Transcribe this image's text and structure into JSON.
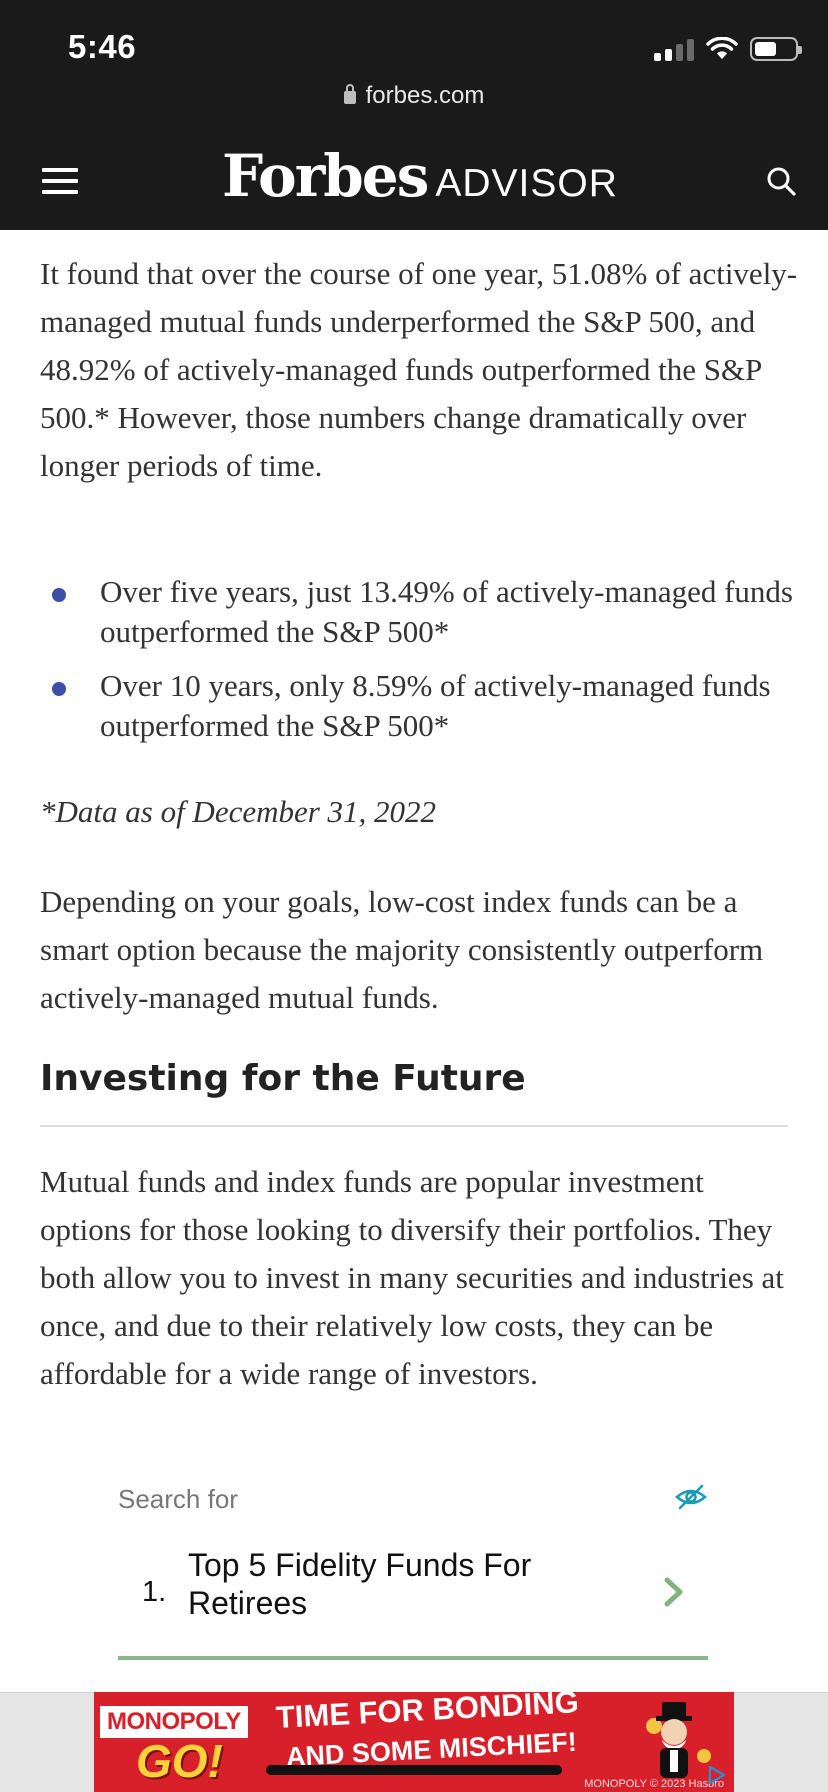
{
  "status_bar": {
    "time": "5:46",
    "signal_bars_filled": 2,
    "signal_bars_total": 4,
    "battery_level": 0.55
  },
  "browser": {
    "url": "forbes.com"
  },
  "header": {
    "logo_main": "Forbes",
    "logo_sub": "ADVISOR"
  },
  "article": {
    "paragraph_1": "It found that over the course of one year, 51.08% of actively-managed mutual funds underperformed the S&P 500, and 48.92% of actively-managed funds outperformed the S&P 500.* However, those numbers change dramatically over longer periods of time.",
    "bullets": [
      "Over five years, just 13.49% of actively-managed funds outperformed the S&P 500*",
      "Over 10 years, only 8.59% of actively-managed funds outperformed the S&P 500*"
    ],
    "note": "*Data as of December 31, 2022",
    "paragraph_2": "Depending on your goals, low-cost index funds can be a smart option because the majority consistently outperform actively-managed mutual funds.",
    "heading": "Investing for the Future",
    "paragraph_3": "Mutual funds and index funds are popular investment options for those looking to diversify their portfolios. They both allow you to invest in many securities and industries at once, and due to their relatively low costs, they can be affordable for a wide range of investors."
  },
  "search_ad": {
    "label": "Search for",
    "items": [
      {
        "number": "1.",
        "text": "Top 5 Fidelity Funds For Retirees"
      }
    ]
  },
  "banner_ad": {
    "brand_top": "MONOPOLY",
    "brand_go": "GO!",
    "line1": "TIME FOR BONDING",
    "line2": "AND SOME MISCHIEF!",
    "fine_print": "MONOPOLY © 2023 Hasbro"
  },
  "colors": {
    "header_bg": "#1a1a1a",
    "bullet": "#3b4fa8",
    "ad_accent": "#8ab88a",
    "eye_icon": "#1a9bb5",
    "banner_red": "#d8202b"
  }
}
